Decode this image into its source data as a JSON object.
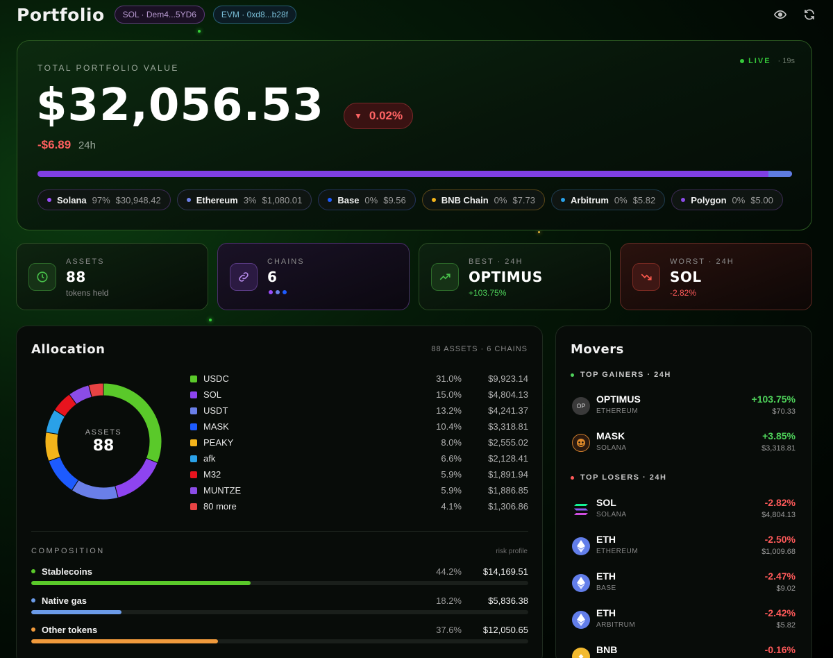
{
  "header": {
    "title": "Portfolio",
    "sol_address": "SOL · Dem4...5YD6",
    "evm_address": "EVM · 0xd8...b28f",
    "icons": [
      "eye-icon",
      "refresh-icon"
    ]
  },
  "hero": {
    "label": "TOTAL PORTFOLIO VALUE",
    "live_label": "LIVE",
    "live_age": "· 19s",
    "total_value": "$32,056.53",
    "change_pct": "0.02%",
    "change_abs": "-$6.89",
    "change_period": "24h",
    "chains": [
      {
        "name": "Solana",
        "pct": "97%",
        "value": "$30,948.42",
        "color": "#9b4dfa",
        "border": "#3d2a55"
      },
      {
        "name": "Ethereum",
        "pct": "3%",
        "value": "$1,080.01",
        "color": "#6c80e8",
        "border": "#2f3552"
      },
      {
        "name": "Base",
        "pct": "0%",
        "value": "$9.56",
        "color": "#1d5bff",
        "border": "#22325a"
      },
      {
        "name": "BNB Chain",
        "pct": "0%",
        "value": "$7.73",
        "color": "#f3b41b",
        "border": "#5a4718"
      },
      {
        "name": "Arbitrum",
        "pct": "0%",
        "value": "$5.82",
        "color": "#2aa1e8",
        "border": "#1e3b4e"
      },
      {
        "name": "Polygon",
        "pct": "0%",
        "value": "$5.00",
        "color": "#8b4ce6",
        "border": "#3a2a52"
      }
    ],
    "bar_colors": {
      "primary": "#7f3fe3",
      "secondary": "#5e7ce0"
    }
  },
  "stats": {
    "assets": {
      "label": "ASSETS",
      "value": "88",
      "sub": "tokens held"
    },
    "chains": {
      "label": "CHAINS",
      "value": "6",
      "dots": [
        "#9b4dfa",
        "#6c80e8",
        "#1d5bff"
      ]
    },
    "best": {
      "label": "BEST · 24H",
      "value": "OPTIMUS",
      "sub": "+103.75%"
    },
    "worst": {
      "label": "WORST · 24H",
      "value": "SOL",
      "sub": "-2.82%"
    }
  },
  "allocation": {
    "title": "Allocation",
    "meta": "88 ASSETS · 6 CHAINS",
    "center_label": "ASSETS",
    "center_value": "88",
    "items": [
      {
        "name": "USDC",
        "pct": "31.0%",
        "value": "$9,923.14",
        "share": 31.0,
        "color": "#5ac92a"
      },
      {
        "name": "SOL",
        "pct": "15.0%",
        "value": "$4,804.13",
        "share": 15.0,
        "color": "#8e44f0"
      },
      {
        "name": "USDT",
        "pct": "13.2%",
        "value": "$4,241.37",
        "share": 13.2,
        "color": "#6a7fe8"
      },
      {
        "name": "MASK",
        "pct": "10.4%",
        "value": "$3,318.81",
        "share": 10.4,
        "color": "#1d5bff"
      },
      {
        "name": "PEAKY",
        "pct": "8.0%",
        "value": "$2,555.02",
        "share": 8.0,
        "color": "#f3b41b"
      },
      {
        "name": "afk",
        "pct": "6.6%",
        "value": "$2,128.41",
        "share": 6.6,
        "color": "#2aa1e8"
      },
      {
        "name": "M32",
        "pct": "5.9%",
        "value": "$1,891.94",
        "share": 5.9,
        "color": "#e8141e"
      },
      {
        "name": "MUNTZE",
        "pct": "5.9%",
        "value": "$1,886.85",
        "share": 5.9,
        "color": "#8b4ce6"
      },
      {
        "name": "80 more",
        "pct": "4.1%",
        "value": "$1,306.86",
        "share": 4.1,
        "color": "#e84343"
      }
    ],
    "composition_label": "COMPOSITION",
    "composition_note": "risk profile",
    "composition": [
      {
        "name": "Stablecoins",
        "pct": "44.2%",
        "value": "$14,169.51",
        "fill": 0.442,
        "color": "#5ac92a"
      },
      {
        "name": "Native gas",
        "pct": "18.2%",
        "value": "$5,836.38",
        "fill": 0.182,
        "color": "#6b9be8"
      },
      {
        "name": "Other tokens",
        "pct": "37.6%",
        "value": "$12,050.65",
        "fill": 0.376,
        "color": "#f09a3c"
      }
    ]
  },
  "movers": {
    "title": "Movers",
    "gainers_label": "TOP GAINERS · 24H",
    "losers_label": "TOP LOSERS · 24H",
    "gainers": [
      {
        "symbol": "OPTIMUS",
        "chain": "ETHEREUM",
        "pct": "+103.75%",
        "value": "$70.33",
        "icon": "op-token-icon",
        "icon_text": "OP"
      },
      {
        "symbol": "MASK",
        "chain": "SOLANA",
        "pct": "+3.85%",
        "value": "$3,318.81",
        "icon": "mask-token-icon",
        "icon_text": ""
      }
    ],
    "losers": [
      {
        "symbol": "SOL",
        "chain": "SOLANA",
        "pct": "-2.82%",
        "value": "$4,804.13",
        "icon": "solana-icon"
      },
      {
        "symbol": "ETH",
        "chain": "ETHEREUM",
        "pct": "-2.50%",
        "value": "$1,009.68",
        "icon": "ethereum-icon"
      },
      {
        "symbol": "ETH",
        "chain": "BASE",
        "pct": "-2.47%",
        "value": "$9.02",
        "icon": "ethereum-icon"
      },
      {
        "symbol": "ETH",
        "chain": "ARBITRUM",
        "pct": "-2.42%",
        "value": "$5.82",
        "icon": "ethereum-icon"
      },
      {
        "symbol": "BNB",
        "chain": "",
        "pct": "-0.16%",
        "value": "",
        "icon": "bnb-icon"
      }
    ]
  }
}
